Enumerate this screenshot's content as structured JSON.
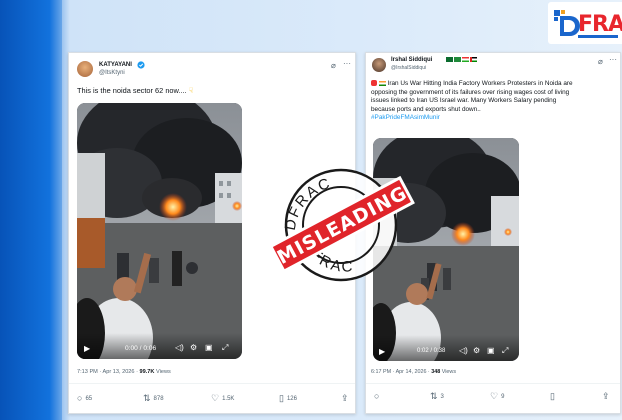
{
  "logo": {
    "text": "FRA"
  },
  "left_tweet": {
    "name": "KATYAYANI",
    "handle": "@ItsKtyni",
    "text": "This is the noida sector 62 now....",
    "video": {
      "time": "0:00 / 0:06"
    },
    "meta": {
      "time": "7:13 PM · Apr 13, 2026 · ",
      "views_count": "99.7K",
      "views_label": " Views"
    },
    "actions": {
      "replies": "65",
      "reposts": "878",
      "likes": "1.5K",
      "bookmarks": "126"
    }
  },
  "right_tweet": {
    "name": "Irshal Siddiqui",
    "handle": "@IrshalSiddiqui",
    "text_line1": "Iran Us War Hitting India Factory Workers Protesters in Noida are",
    "text_line2": "opposing the government of its failures over rising wages  cost of living",
    "text_line3": "issues linked to Iran US Israel war. Many Workers Salary pending",
    "text_line4": "because ports and exports shut down..",
    "hashtag": "#PakPrideFMAsimMunir",
    "video": {
      "time": "0:02 / 0:38"
    },
    "meta": {
      "time": "6:17 PM · Apr 14, 2026 · ",
      "views_count": "348",
      "views_label": " Views"
    },
    "actions": {
      "replies": "",
      "reposts": "3",
      "likes": "9",
      "bookmarks": ""
    }
  },
  "stamp": {
    "top_text": "DFRAC",
    "bottom_text": "DFRAC",
    "label": "MISLEADING"
  },
  "colors": {
    "stamp_red": "#e0242a",
    "brand_blue": "#0d6ad6",
    "link_blue": "#1d9bf0"
  }
}
